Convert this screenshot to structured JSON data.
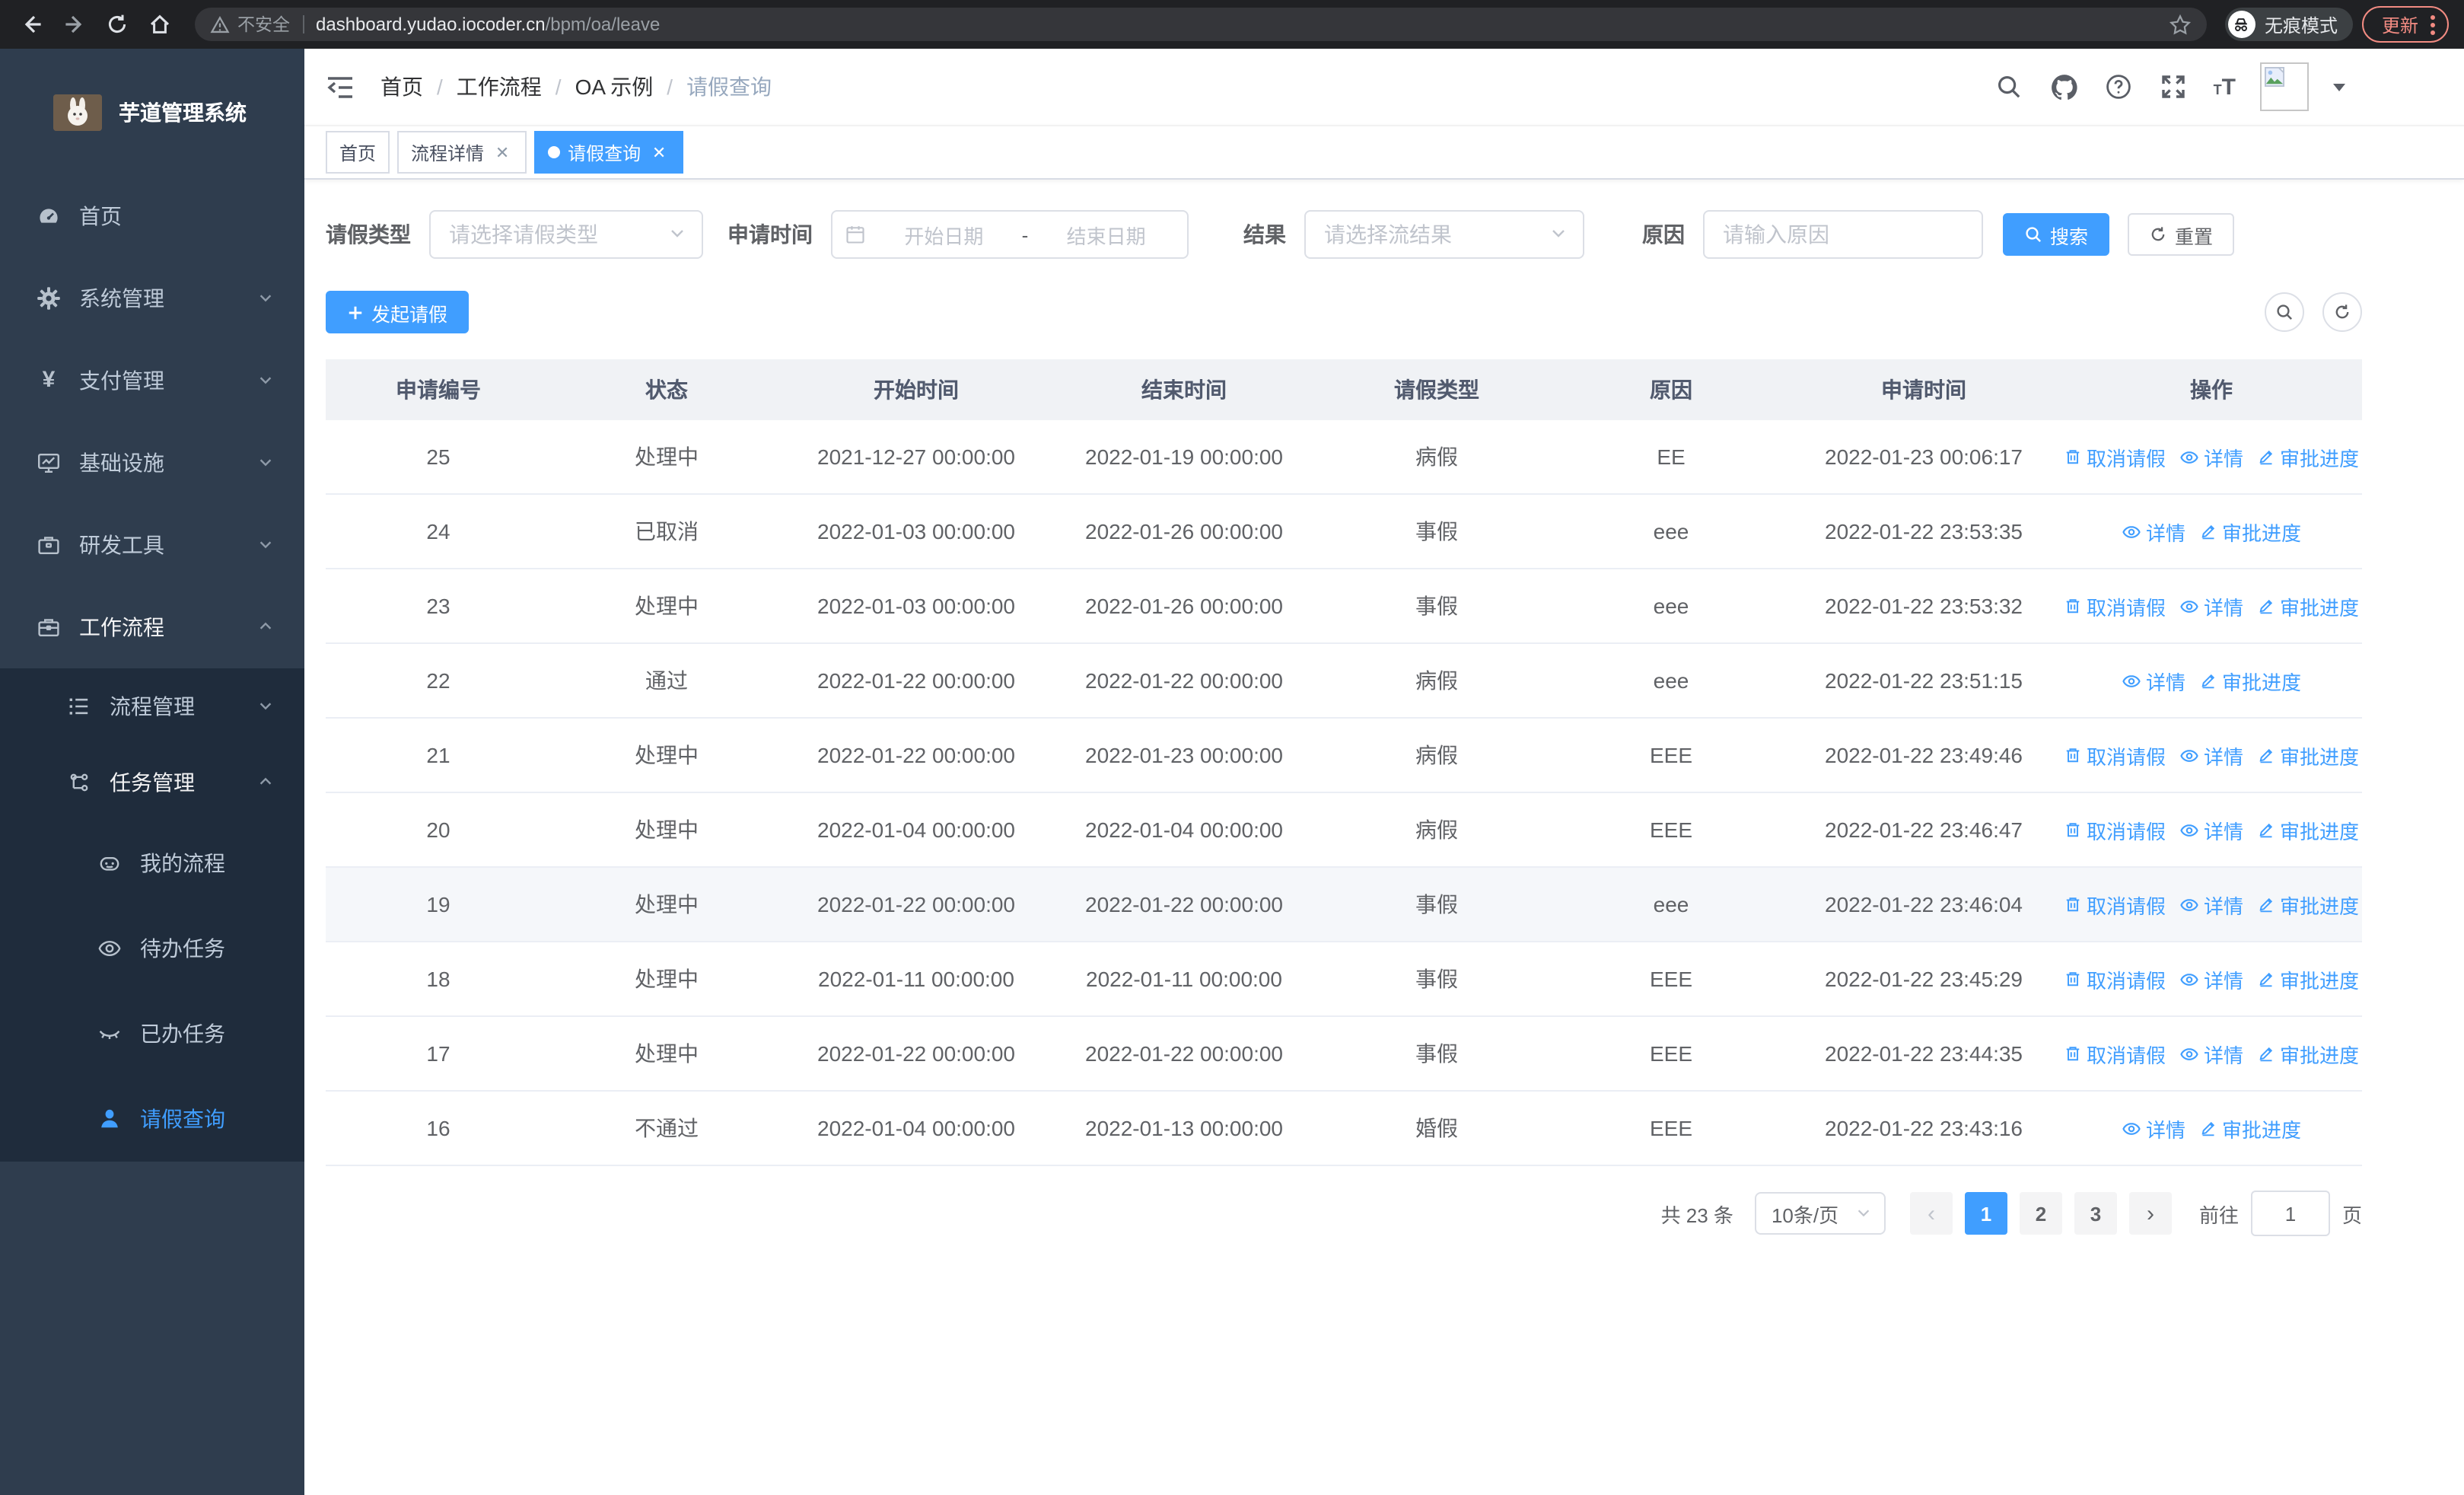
{
  "browser": {
    "security_label": "不安全",
    "url_host": "dashboard.yudao.iocoder.cn",
    "url_path": "/bpm/oa/leave",
    "incognito_label": "无痕模式",
    "update_label": "更新"
  },
  "sidebar": {
    "title": "芋道管理系统",
    "menu": [
      {
        "label": "首页"
      },
      {
        "label": "系统管理"
      },
      {
        "label": "支付管理"
      },
      {
        "label": "基础设施"
      },
      {
        "label": "研发工具"
      },
      {
        "label": "工作流程"
      }
    ],
    "submenu": [
      {
        "label": "流程管理"
      },
      {
        "label": "任务管理"
      }
    ],
    "subitems": [
      {
        "label": "我的流程"
      },
      {
        "label": "待办任务"
      },
      {
        "label": "已办任务"
      },
      {
        "label": "请假查询"
      }
    ]
  },
  "navbar": {
    "breadcrumb": [
      "首页",
      "工作流程",
      "OA 示例",
      "请假查询"
    ]
  },
  "tags": [
    {
      "label": "首页"
    },
    {
      "label": "流程详情"
    },
    {
      "label": "请假查询"
    }
  ],
  "filters": {
    "type_label": "请假类型",
    "type_placeholder": "请选择请假类型",
    "time_label": "申请时间",
    "start_placeholder": "开始日期",
    "range_separator": "-",
    "end_placeholder": "结束日期",
    "result_label": "结果",
    "result_placeholder": "请选择流结果",
    "reason_label": "原因",
    "reason_placeholder": "请输入原因",
    "search_label": "搜索",
    "reset_label": "重置"
  },
  "toolbar": {
    "create_label": "发起请假"
  },
  "table": {
    "columns": [
      "申请编号",
      "状态",
      "开始时间",
      "结束时间",
      "请假类型",
      "原因",
      "申请时间",
      "操作"
    ],
    "action_labels": {
      "cancel": "取消请假",
      "detail": "详情",
      "progress": "审批进度"
    },
    "rows": [
      {
        "id": "25",
        "status": "处理中",
        "start": "2021-12-27 00:00:00",
        "end": "2022-01-19 00:00:00",
        "type": "病假",
        "reason": "EE",
        "applied": "2022-01-23 00:06:17",
        "actions": [
          "cancel",
          "detail",
          "progress"
        ],
        "hover": false
      },
      {
        "id": "24",
        "status": "已取消",
        "start": "2022-01-03 00:00:00",
        "end": "2022-01-26 00:00:00",
        "type": "事假",
        "reason": "eee",
        "applied": "2022-01-22 23:53:35",
        "actions": [
          "detail",
          "progress"
        ],
        "hover": false
      },
      {
        "id": "23",
        "status": "处理中",
        "start": "2022-01-03 00:00:00",
        "end": "2022-01-26 00:00:00",
        "type": "事假",
        "reason": "eee",
        "applied": "2022-01-22 23:53:32",
        "actions": [
          "cancel",
          "detail",
          "progress"
        ],
        "hover": false
      },
      {
        "id": "22",
        "status": "通过",
        "start": "2022-01-22 00:00:00",
        "end": "2022-01-22 00:00:00",
        "type": "病假",
        "reason": "eee",
        "applied": "2022-01-22 23:51:15",
        "actions": [
          "detail",
          "progress"
        ],
        "hover": false
      },
      {
        "id": "21",
        "status": "处理中",
        "start": "2022-01-22 00:00:00",
        "end": "2022-01-23 00:00:00",
        "type": "病假",
        "reason": "EEE",
        "applied": "2022-01-22 23:49:46",
        "actions": [
          "cancel",
          "detail",
          "progress"
        ],
        "hover": false
      },
      {
        "id": "20",
        "status": "处理中",
        "start": "2022-01-04 00:00:00",
        "end": "2022-01-04 00:00:00",
        "type": "病假",
        "reason": "EEE",
        "applied": "2022-01-22 23:46:47",
        "actions": [
          "cancel",
          "detail",
          "progress"
        ],
        "hover": false
      },
      {
        "id": "19",
        "status": "处理中",
        "start": "2022-01-22 00:00:00",
        "end": "2022-01-22 00:00:00",
        "type": "事假",
        "reason": "eee",
        "applied": "2022-01-22 23:46:04",
        "actions": [
          "cancel",
          "detail",
          "progress"
        ],
        "hover": true
      },
      {
        "id": "18",
        "status": "处理中",
        "start": "2022-01-11 00:00:00",
        "end": "2022-01-11 00:00:00",
        "type": "事假",
        "reason": "EEE",
        "applied": "2022-01-22 23:45:29",
        "actions": [
          "cancel",
          "detail",
          "progress"
        ],
        "hover": false
      },
      {
        "id": "17",
        "status": "处理中",
        "start": "2022-01-22 00:00:00",
        "end": "2022-01-22 00:00:00",
        "type": "事假",
        "reason": "EEE",
        "applied": "2022-01-22 23:44:35",
        "actions": [
          "cancel",
          "detail",
          "progress"
        ],
        "hover": false
      },
      {
        "id": "16",
        "status": "不通过",
        "start": "2022-01-04 00:00:00",
        "end": "2022-01-13 00:00:00",
        "type": "婚假",
        "reason": "EEE",
        "applied": "2022-01-22 23:43:16",
        "actions": [
          "detail",
          "progress"
        ],
        "hover": false
      }
    ]
  },
  "pagination": {
    "total_label": "共 23 条",
    "page_size": "10条/页",
    "pages": [
      "1",
      "2",
      "3"
    ],
    "active_page": "1",
    "goto_label": "前往",
    "goto_value": "1",
    "page_unit": "页"
  },
  "colors": {
    "primary": "#409eff",
    "sidebar_bg": "#2f3d4e",
    "submenu_bg": "#1f2c3c",
    "chrome_bg": "#202124",
    "update_accent": "#f28b82"
  }
}
